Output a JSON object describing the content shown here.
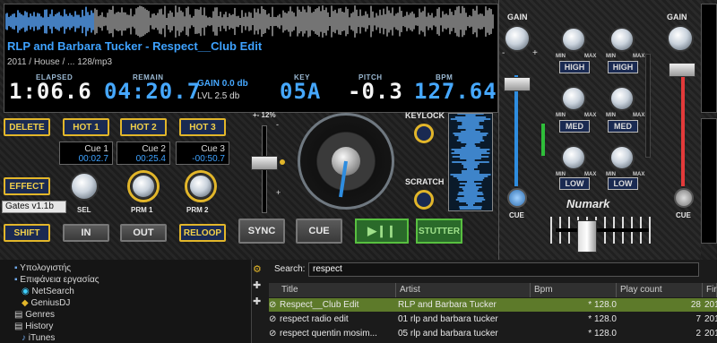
{
  "deck": {
    "track_title": "RLP and Barbara Tucker - Respect__Club Edit",
    "track_meta": "2011 / House / ... 128/mp3",
    "elapsed_label": "ELAPSED",
    "elapsed": "1:06.6",
    "remain_label": "REMAIN",
    "remain": "04:20.7",
    "gain_text": "GAIN 0.0 db",
    "lvl_text": "LVL 2.5 db",
    "key_label": "KEY",
    "key": "05A",
    "pitch_label": "PITCH",
    "pitch": "-0.3",
    "bpm_label": "BPM",
    "bpm": "127.64",
    "pitch_range": "+- 12%",
    "keylock_label": "KEYLOCK",
    "scratch_label": "SCRATCH",
    "delete_label": "DELETE",
    "hot_labels": [
      "HOT 1",
      "HOT 2",
      "HOT 3"
    ],
    "cues": [
      {
        "name": "Cue 1",
        "time": "00:02.7"
      },
      {
        "name": "Cue 2",
        "time": "00:25.4"
      },
      {
        "name": "Cue 3",
        "time": "-00:50.7"
      }
    ],
    "effect_label": "EFFECT",
    "effect_name": "Gates v1.1b",
    "sel_label": "SEL",
    "prm1_label": "PRM 1",
    "prm2_label": "PRM 2",
    "shift_label": "SHIFT",
    "in_label": "IN",
    "out_label": "OUT",
    "reloop_label": "RELOOP",
    "sync_label": "SYNC",
    "cue_label": "CUE",
    "play_label": "▶❙❙",
    "stutter_label": "STUTTER",
    "pitch_plus": "+",
    "pitch_minus": "-"
  },
  "mixer": {
    "gain_label": "GAIN",
    "gain_label_right": "GAIN",
    "high_label": "HIGH",
    "med_label": "MED",
    "low_label": "LOW",
    "min_label": "MIN",
    "max_label": "MAX",
    "cue_label": "CUE",
    "cue_label_right": "CUE",
    "brand": "Numark",
    "minus": "-",
    "plus": "+"
  },
  "browser": {
    "tree": [
      "Υπολογιστής",
      "Επιφάνεια εργασίας",
      "NetSearch",
      "GeniusDJ",
      "Genres",
      "History",
      "iTunes"
    ],
    "search_label": "Search:",
    "search_value": "respect",
    "columns": [
      "Title",
      "Artist",
      "Bpm",
      "Play count",
      "Firs"
    ],
    "rows": [
      {
        "title": "Respect__Club Edit",
        "artist": "RLP and Barbara Tucker",
        "bpm": "* 128.0",
        "plays": "28",
        "first": "201"
      },
      {
        "title": "respect  radio edit",
        "artist": "01 rlp and barbara tucker",
        "bpm": "* 128.0",
        "plays": "7",
        "first": "201"
      },
      {
        "title": "respect  quentin mosim...",
        "artist": "05 rlp and barbara tucker",
        "bpm": "* 128.0",
        "plays": "2",
        "first": "201"
      }
    ]
  },
  "colors": {
    "accent": "#3ea2ff",
    "gold": "#e2b62a",
    "green": "#58c040",
    "playing_row": "#5d7a2a"
  }
}
